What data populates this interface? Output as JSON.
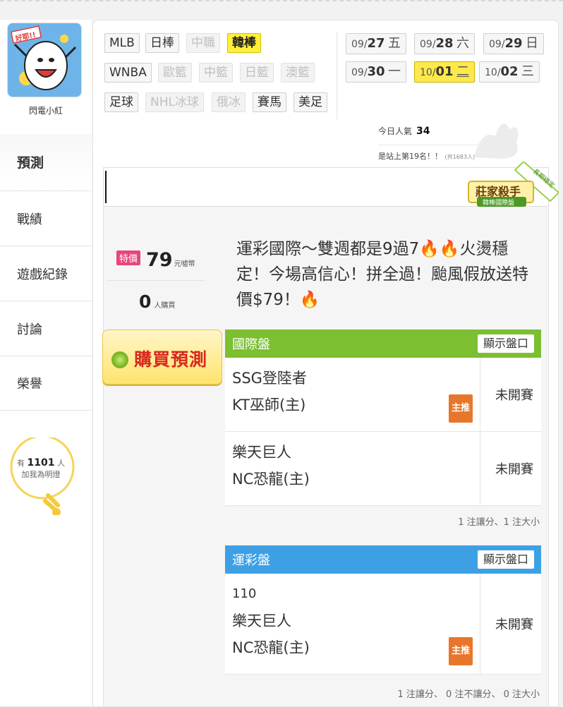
{
  "user": {
    "name": "閃電小紅",
    "avatar_text": "好耶!!"
  },
  "sidebar": {
    "items": [
      {
        "label": "預測"
      },
      {
        "label": "戰績"
      },
      {
        "label": "遊戲紀錄"
      },
      {
        "label": "討論"
      },
      {
        "label": "榮譽"
      }
    ]
  },
  "fans": {
    "prefix": "有",
    "count": "1101",
    "suffix": "人",
    "line2": "加我為明燈"
  },
  "categories": [
    {
      "label": "MLB",
      "state": "normal"
    },
    {
      "label": "日棒",
      "state": "normal"
    },
    {
      "label": "中職",
      "state": "disabled"
    },
    {
      "label": "韓棒",
      "state": "active"
    },
    {
      "label": "WNBA",
      "state": "normal"
    },
    {
      "label": "歐籃",
      "state": "disabled"
    },
    {
      "label": "中籃",
      "state": "disabled"
    },
    {
      "label": "日籃",
      "state": "disabled"
    },
    {
      "label": "澳籃",
      "state": "disabled"
    },
    {
      "label": "足球",
      "state": "normal"
    },
    {
      "label": "NHL冰球",
      "state": "disabled"
    },
    {
      "label": "俄冰",
      "state": "disabled"
    },
    {
      "label": "賽馬",
      "state": "normal"
    },
    {
      "label": "美足",
      "state": "normal"
    }
  ],
  "dates": [
    {
      "month": "09/",
      "day": "27",
      "weekday": "五"
    },
    {
      "month": "09/",
      "day": "28",
      "weekday": "六"
    },
    {
      "month": "09/",
      "day": "29",
      "weekday": "日"
    },
    {
      "month": "09/",
      "day": "30",
      "weekday": "一"
    },
    {
      "month": "10/",
      "day": "01",
      "weekday": "二",
      "active": true
    },
    {
      "month": "10/",
      "day": "02",
      "weekday": "三"
    }
  ],
  "popularity": {
    "label": "今日人氣",
    "value": "34",
    "rank_text": "是站上第19名！！",
    "rank_total": "(共1683人)"
  },
  "badge": {
    "title": "莊家殺手",
    "subtitle": "韓棒國際盤",
    "ribbon": "長期穩定"
  },
  "prediction": {
    "tag": "特價",
    "price": "79",
    "unit": "元噓幣",
    "buyers": "0",
    "buyers_unit": "人購買",
    "buy_label": "購買預測",
    "headline": "運彩國際～雙週都是9過7🔥🔥火燙穩定！今場高信心！拼全過！颱風假放送特價$79！🔥"
  },
  "tables": [
    {
      "title": "國際盤",
      "show_btn": "顯示盤口",
      "rows": [
        {
          "teams": [
            "SSG登陸者",
            "KT巫師(主)"
          ],
          "status": "未開賽",
          "main_tag": "主推"
        },
        {
          "teams": [
            "樂天巨人",
            "NC恐龍(主)"
          ],
          "status": "未開賽",
          "main_tag": ""
        }
      ],
      "note": "1 注讓分、1 注大小"
    },
    {
      "title": "運彩盤",
      "show_btn": "顯示盤口",
      "rows": [
        {
          "teams": [
            "110",
            "樂天巨人",
            "NC恐龍(主)"
          ],
          "status": "未開賽",
          "main_tag": "主推"
        }
      ],
      "note": "1 注讓分、 0 注不讓分、 0 注大小"
    }
  ]
}
